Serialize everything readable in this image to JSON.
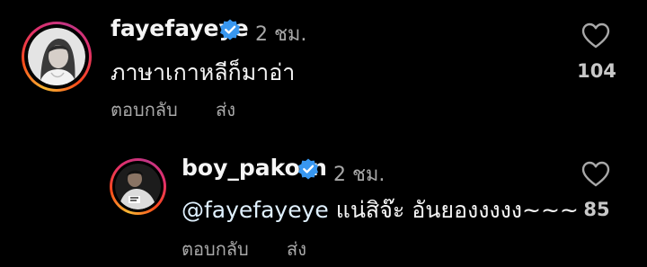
{
  "comment": {
    "username": "fayefayeye",
    "verified_icon": "verified-badge-icon",
    "time": "2 ชม.",
    "text": "ภาษาเกาหลีก็มาอ่า",
    "reply_label": "ตอบกลับ",
    "send_label": "ส่ง",
    "likes": "104",
    "like_icon": "heart-outline-icon"
  },
  "reply": {
    "username": "boy_pakorn",
    "verified_icon": "verified-badge-icon",
    "time": "2 ชม.",
    "mention": "@fayefayeye",
    "text": " แน่สิจ๊ะ อันยองงงงง~~~",
    "reply_label": "ตอบกลับ",
    "send_label": "ส่ง",
    "likes": "85",
    "like_icon": "heart-outline-icon"
  },
  "colors": {
    "background": "#000000",
    "primary_text": "#f5f5f5",
    "secondary_text": "#a8a8a8",
    "verified_blue": "#3897f0",
    "mention": "#e0f1ff"
  }
}
